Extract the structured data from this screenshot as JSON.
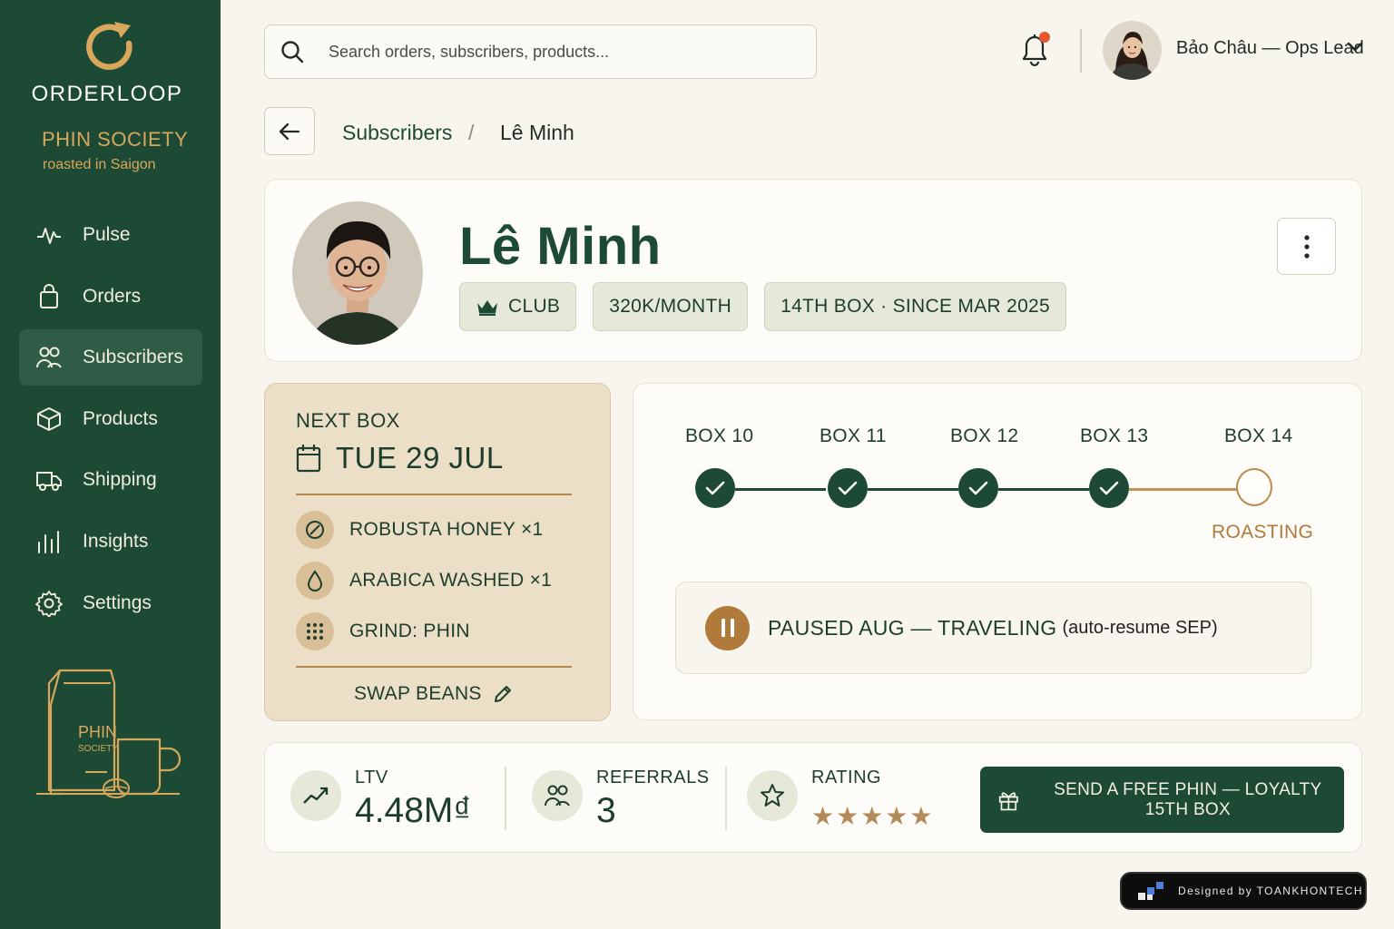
{
  "sidebar": {
    "brand": "ORDERLOOP",
    "shop_name": "PHIN SOCIETY",
    "shop_tagline": "roasted in Saigon",
    "items": [
      {
        "label": "Pulse",
        "icon": "pulse-icon"
      },
      {
        "label": "Orders",
        "icon": "bag-icon"
      },
      {
        "label": "Subscribers",
        "icon": "users-icon",
        "active": true
      },
      {
        "label": "Products",
        "icon": "box-icon"
      },
      {
        "label": "Shipping",
        "icon": "truck-icon"
      },
      {
        "label": "Insights",
        "icon": "bar-chart-icon"
      },
      {
        "label": "Settings",
        "icon": "gear-icon"
      }
    ],
    "illustration": {
      "line1": "PHIN",
      "line2": "SOCIETY"
    }
  },
  "topbar": {
    "search_placeholder": "Search orders, subscribers, products...",
    "user": "Bảo Châu — Ops Lead",
    "has_notification": true
  },
  "breadcrumb": {
    "parent": "Subscribers",
    "separator": "/",
    "current": "Lê Minh"
  },
  "profile": {
    "name": "Lê Minh",
    "tier": "CLUB",
    "price": "320K/MONTH",
    "tenure": "14TH BOX · SINCE MAR 2025"
  },
  "next_box": {
    "label": "NEXT BOX",
    "date": "TUE 29 JUL",
    "items": [
      {
        "label": "ROBUSTA HONEY ×1",
        "icon": "coffee-bean-icon"
      },
      {
        "label": "ARABICA WASHED ×1",
        "icon": "drop-icon"
      },
      {
        "label": "GRIND: PHIN",
        "icon": "grind-dots-icon"
      }
    ],
    "action": "SWAP BEANS"
  },
  "timeline": {
    "boxes": [
      {
        "label": "BOX 10",
        "done": true
      },
      {
        "label": "BOX 11",
        "done": true
      },
      {
        "label": "BOX 12",
        "done": true
      },
      {
        "label": "BOX 13",
        "done": true
      },
      {
        "label": "BOX 14",
        "done": false
      }
    ],
    "current_status": "ROASTING",
    "pause_main": "PAUSED AUG — TRAVELING",
    "pause_sub": "(auto-resume SEP)"
  },
  "stats": {
    "ltv": {
      "label": "LTV",
      "value": "4.48M₫"
    },
    "referrals": {
      "label": "REFERRALS",
      "value": "3"
    },
    "rating": {
      "label": "RATING",
      "stars": 5
    },
    "cta": "SEND A FREE PHIN — LOYALTY 15TH BOX"
  },
  "credit": "Designed by TOANKHONTECH",
  "colors": {
    "primary": "#1d4a35",
    "accent": "#b07a3a",
    "gold": "#d9a75c",
    "notification": "#e8552e"
  }
}
